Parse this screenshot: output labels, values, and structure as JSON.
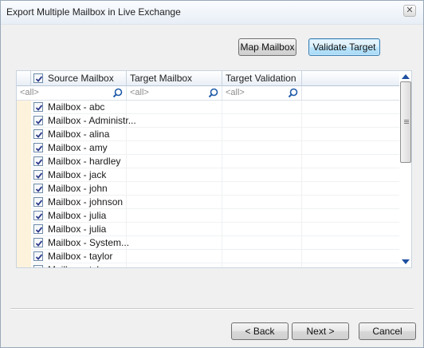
{
  "window": {
    "title": "Export Multiple Mailbox in Live Exchange"
  },
  "toolbar": {
    "map_mailbox": "Map Mailbox",
    "validate_target": "Validate Target"
  },
  "grid": {
    "columns": [
      "Source Mailbox",
      "Target Mailbox",
      "Target Validation"
    ],
    "filter_placeholder": "<all>",
    "rows": [
      {
        "source": "Mailbox - abc",
        "target": "",
        "validation": "",
        "checked": true
      },
      {
        "source": "Mailbox - Administr...",
        "target": "",
        "validation": "",
        "checked": true
      },
      {
        "source": "Mailbox - alina",
        "target": "",
        "validation": "",
        "checked": true
      },
      {
        "source": "Mailbox - amy",
        "target": "",
        "validation": "",
        "checked": true
      },
      {
        "source": "Mailbox - hardley",
        "target": "",
        "validation": "",
        "checked": true
      },
      {
        "source": "Mailbox - jack",
        "target": "",
        "validation": "",
        "checked": true
      },
      {
        "source": "Mailbox - john",
        "target": "",
        "validation": "",
        "checked": true
      },
      {
        "source": "Mailbox - johnson",
        "target": "",
        "validation": "",
        "checked": true
      },
      {
        "source": "Mailbox - julia",
        "target": "",
        "validation": "",
        "checked": true
      },
      {
        "source": "Mailbox - julia",
        "target": "",
        "validation": "",
        "checked": true
      },
      {
        "source": "Mailbox - System...",
        "target": "",
        "validation": "",
        "checked": true
      },
      {
        "source": "Mailbox - taylor",
        "target": "",
        "validation": "",
        "checked": true
      },
      {
        "source": "Mailbox - tyl...",
        "target": "",
        "validation": "",
        "checked": true
      }
    ]
  },
  "footer": {
    "back": "< Back",
    "next": "Next >",
    "cancel": "Cancel"
  },
  "icons": {
    "close": "close-icon",
    "filter": "magnifier-icon",
    "check": "checkmark-icon"
  },
  "colors": {
    "row_gutter": "#fdf2dc",
    "header_bg": "#e9eff6",
    "accent": "#1e50a0"
  }
}
